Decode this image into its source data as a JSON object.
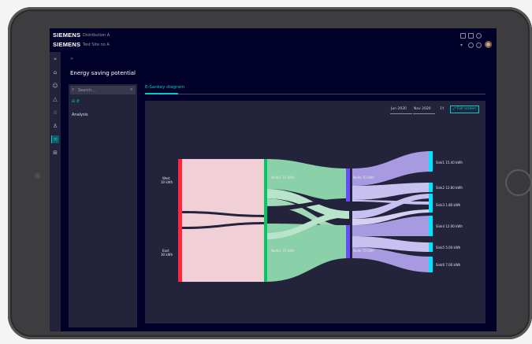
{
  "topbar": {
    "brand_top": "SIEMENS",
    "brand_bottom": "SIEMENS",
    "app_top": "Distribution A",
    "app_bottom": "Test Site no A"
  },
  "sidenav": {
    "items": [
      "expand",
      "home",
      "user",
      "alert",
      "star",
      "pin",
      "sankey",
      "grid"
    ]
  },
  "breadcrumb": ">",
  "page_title": "Energy saving potential",
  "left_panel": {
    "search_placeholder": "Search...",
    "filter_label": "⊟ ⇵",
    "tree_item": "Analysis"
  },
  "tab": {
    "label": "E-Sankey diagram"
  },
  "toolbar": {
    "date_from": "Jun 2020",
    "date_to": "Nov 2020",
    "range_label": "1Y",
    "fullscreen_label": "⤢ Full screen"
  },
  "colors": {
    "accent": "#00cccc",
    "background": "#000028",
    "panel": "#23233c",
    "source_node": "#ff2640",
    "mid_node": "#00c864",
    "mid2_node": "#6a4cff",
    "sink_node": "#00e5ff"
  },
  "chart_data": {
    "type": "sankey",
    "nodes": {
      "sources": [
        {
          "label": "West",
          "sublabel": "30 kWh"
        },
        {
          "label": "East",
          "sublabel": "30 kWh"
        }
      ],
      "level1": [
        {
          "label": "Node1 70 kWh"
        },
        {
          "label": "Node1 70 kWh"
        }
      ],
      "level2": [
        {
          "label": "Node 70 kWh"
        },
        {
          "label": "Node 70 kWh"
        }
      ],
      "sinks": [
        {
          "label": "Sink1 15.40 kWh"
        },
        {
          "label": "Sink2 12.80 kWh"
        },
        {
          "label": "Sink3 1.80 kWh"
        },
        {
          "label": "Sink4 12.00 kWh"
        },
        {
          "label": "Sink5 5.00 kWh"
        },
        {
          "label": "Sink6 7.00 kWh"
        }
      ]
    }
  }
}
